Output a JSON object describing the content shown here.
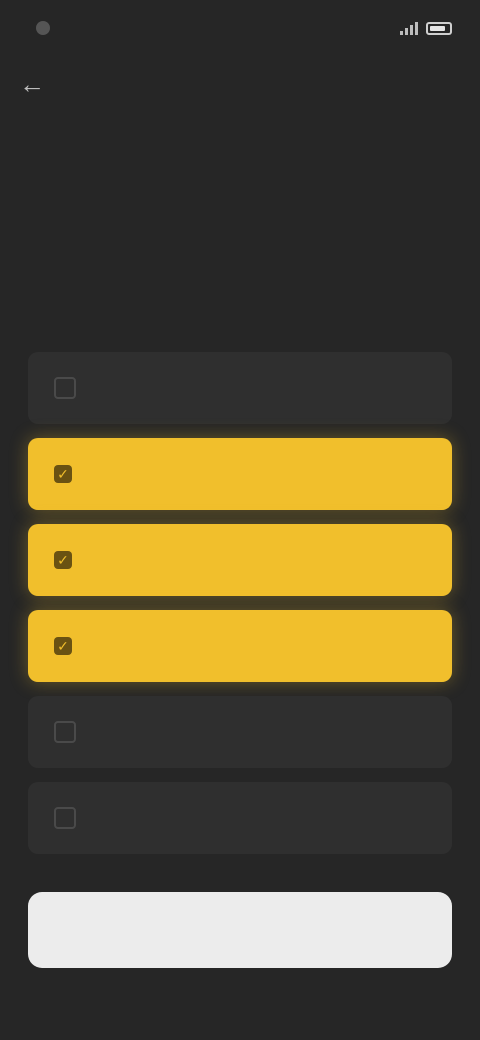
{
  "status_bar": {
    "time": ""
  },
  "header": {
    "title": ""
  },
  "options": [
    {
      "label": "",
      "selected": false,
      "emoji": ""
    },
    {
      "label": "",
      "selected": true,
      "emoji": ""
    },
    {
      "label": "",
      "selected": true,
      "emoji": ""
    },
    {
      "label": "",
      "selected": true,
      "emoji": ""
    },
    {
      "label": "",
      "selected": false,
      "emoji": ""
    },
    {
      "label": "",
      "selected": false,
      "emoji": ""
    }
  ],
  "footer": {
    "continue_label": ""
  },
  "colors": {
    "background": "#262626",
    "selected": "#f1bf2c",
    "unselected": "#2f2f2f",
    "button": "#ececec"
  },
  "icons": {
    "back": "back-arrow-icon",
    "check": "check-icon"
  }
}
